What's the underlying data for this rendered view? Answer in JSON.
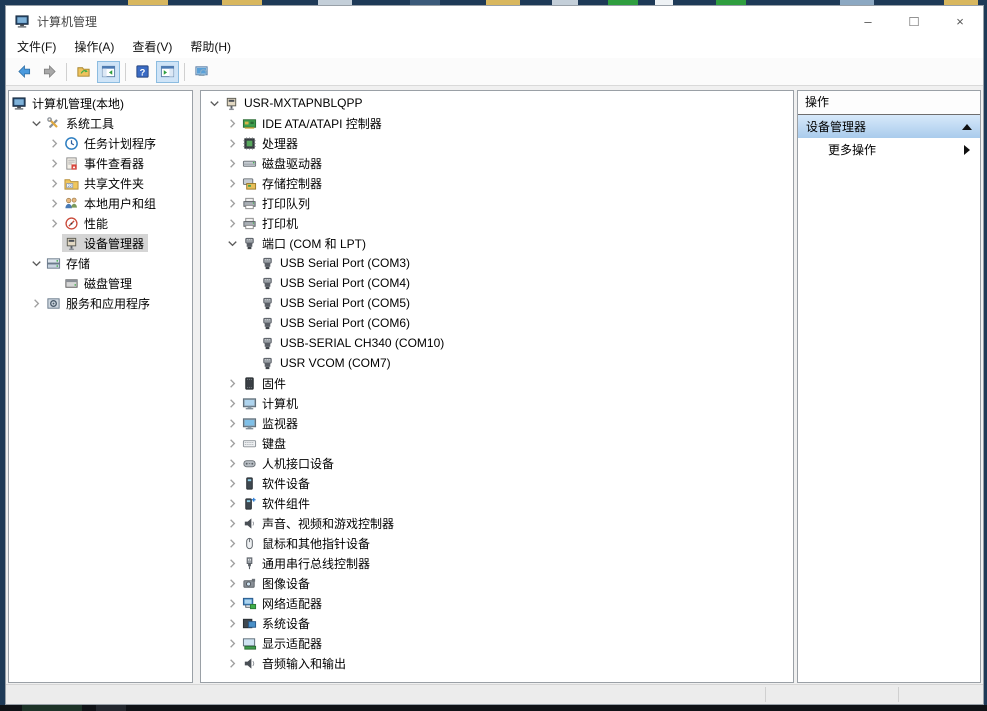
{
  "window": {
    "title": "计算机管理",
    "controls": [
      {
        "name": "minimize-button",
        "glyph": "–"
      },
      {
        "name": "maximize-button",
        "glyph": "□"
      },
      {
        "name": "close-button",
        "glyph": "×"
      }
    ]
  },
  "menu": {
    "items": [
      {
        "label": "文件(F)"
      },
      {
        "label": "操作(A)"
      },
      {
        "label": "查看(V)"
      },
      {
        "label": "帮助(H)"
      }
    ]
  },
  "toolbar": {
    "buttons": [
      {
        "name": "back-button",
        "icon": "back-arrow-icon",
        "active": false
      },
      {
        "name": "forward-button",
        "icon": "forward-arrow-icon",
        "active": false
      },
      {
        "name": "separator"
      },
      {
        "name": "export-list-button",
        "icon": "export-folder-icon",
        "active": false
      },
      {
        "name": "console-tree-toggle-button",
        "icon": "console-tree-icon",
        "active": true
      },
      {
        "name": "separator"
      },
      {
        "name": "help-button",
        "icon": "help-icon",
        "active": false
      },
      {
        "name": "action-pane-toggle-button",
        "icon": "action-pane-icon",
        "active": true
      },
      {
        "name": "separator"
      },
      {
        "name": "popup-window-button",
        "icon": "monitor-search-icon",
        "active": false
      }
    ]
  },
  "left_tree": {
    "items": [
      {
        "name": "sidebar-item-computer-management-local",
        "depth": 0,
        "chevron": "none",
        "icon": "computer-management-icon",
        "label": "计算机管理(本地)"
      },
      {
        "name": "sidebar-item-system-tools",
        "depth": 1,
        "chevron": "down",
        "icon": "system-tools-icon",
        "label": "系统工具"
      },
      {
        "name": "sidebar-item-task-scheduler",
        "depth": 2,
        "chevron": "right",
        "icon": "task-scheduler-icon",
        "label": "任务计划程序"
      },
      {
        "name": "sidebar-item-event-viewer",
        "depth": 2,
        "chevron": "right",
        "icon": "event-viewer-icon",
        "label": "事件查看器"
      },
      {
        "name": "sidebar-item-shared-folders",
        "depth": 2,
        "chevron": "right",
        "icon": "shared-folders-icon",
        "label": "共享文件夹"
      },
      {
        "name": "sidebar-item-local-users-groups",
        "depth": 2,
        "chevron": "right",
        "icon": "local-users-icon",
        "label": "本地用户和组"
      },
      {
        "name": "sidebar-item-performance",
        "depth": 2,
        "chevron": "right",
        "icon": "performance-icon",
        "label": "性能"
      },
      {
        "name": "sidebar-item-device-manager",
        "depth": 2,
        "chevron": "none",
        "icon": "device-manager-icon",
        "label": "设备管理器",
        "selected": true
      },
      {
        "name": "sidebar-item-storage",
        "depth": 1,
        "chevron": "down",
        "icon": "storage-icon",
        "label": "存储"
      },
      {
        "name": "sidebar-item-disk-management",
        "depth": 2,
        "chevron": "none",
        "icon": "disk-management-icon",
        "label": "磁盘管理"
      },
      {
        "name": "sidebar-item-services-applications",
        "depth": 1,
        "chevron": "right",
        "icon": "services-icon",
        "label": "服务和应用程序"
      }
    ]
  },
  "device_tree": {
    "items": [
      {
        "name": "device-node-root",
        "depth": 0,
        "chevron": "down",
        "icon": "device-manager-icon",
        "label": "USR-MXTAPNBLQPP"
      },
      {
        "name": "device-node-ide-controllers",
        "depth": 1,
        "chevron": "right",
        "icon": "ide-controller-icon",
        "label": "IDE ATA/ATAPI 控制器"
      },
      {
        "name": "device-node-processors",
        "depth": 1,
        "chevron": "right",
        "icon": "processor-icon",
        "label": "处理器"
      },
      {
        "name": "device-node-disk-drives",
        "depth": 1,
        "chevron": "right",
        "icon": "disk-drive-icon",
        "label": "磁盘驱动器"
      },
      {
        "name": "device-node-storage-controllers",
        "depth": 1,
        "chevron": "right",
        "icon": "storage-controller-icon",
        "label": "存储控制器"
      },
      {
        "name": "device-node-print-queues",
        "depth": 1,
        "chevron": "right",
        "icon": "print-queue-icon",
        "label": "打印队列"
      },
      {
        "name": "device-node-printers",
        "depth": 1,
        "chevron": "right",
        "icon": "printer-icon",
        "label": "打印机"
      },
      {
        "name": "device-node-ports-com-lpt",
        "depth": 1,
        "chevron": "down",
        "icon": "serial-port-icon",
        "label": "端口 (COM 和 LPT)"
      },
      {
        "name": "device-node-com3",
        "depth": 2,
        "chevron": "none",
        "icon": "serial-port-icon",
        "label": "USB Serial Port (COM3)"
      },
      {
        "name": "device-node-com4",
        "depth": 2,
        "chevron": "none",
        "icon": "serial-port-icon",
        "label": "USB Serial Port (COM4)"
      },
      {
        "name": "device-node-com5",
        "depth": 2,
        "chevron": "none",
        "icon": "serial-port-icon",
        "label": "USB Serial Port (COM5)"
      },
      {
        "name": "device-node-com6",
        "depth": 2,
        "chevron": "none",
        "icon": "serial-port-icon",
        "label": "USB Serial Port (COM6)"
      },
      {
        "name": "device-node-com10-ch340",
        "depth": 2,
        "chevron": "none",
        "icon": "serial-port-icon",
        "label": "USB-SERIAL CH340 (COM10)"
      },
      {
        "name": "device-node-com7-usr-vcom",
        "depth": 2,
        "chevron": "none",
        "icon": "serial-port-icon",
        "label": "USR VCOM (COM7)"
      },
      {
        "name": "device-node-firmware",
        "depth": 1,
        "chevron": "right",
        "icon": "firmware-icon",
        "label": "固件"
      },
      {
        "name": "device-node-computer",
        "depth": 1,
        "chevron": "right",
        "icon": "computer-icon",
        "label": "计算机"
      },
      {
        "name": "device-node-monitors",
        "depth": 1,
        "chevron": "right",
        "icon": "monitor-icon",
        "label": "监视器"
      },
      {
        "name": "device-node-keyboards",
        "depth": 1,
        "chevron": "right",
        "icon": "keyboard-icon",
        "label": "键盘"
      },
      {
        "name": "device-node-hid-devices",
        "depth": 1,
        "chevron": "right",
        "icon": "hid-icon",
        "label": "人机接口设备"
      },
      {
        "name": "device-node-software-devices",
        "depth": 1,
        "chevron": "right",
        "icon": "software-device-icon",
        "label": "软件设备"
      },
      {
        "name": "device-node-software-components",
        "depth": 1,
        "chevron": "right",
        "icon": "software-component-icon",
        "label": "软件组件"
      },
      {
        "name": "device-node-sound-video-game",
        "depth": 1,
        "chevron": "right",
        "icon": "sound-icon",
        "label": "声音、视频和游戏控制器"
      },
      {
        "name": "device-node-mice-pointing",
        "depth": 1,
        "chevron": "right",
        "icon": "mouse-icon",
        "label": "鼠标和其他指针设备"
      },
      {
        "name": "device-node-usb-controllers",
        "depth": 1,
        "chevron": "right",
        "icon": "usb-icon",
        "label": "通用串行总线控制器"
      },
      {
        "name": "device-node-imaging-devices",
        "depth": 1,
        "chevron": "right",
        "icon": "imaging-device-icon",
        "label": "图像设备"
      },
      {
        "name": "device-node-network-adapters",
        "depth": 1,
        "chevron": "right",
        "icon": "network-adapter-icon",
        "label": "网络适配器"
      },
      {
        "name": "device-node-system-devices",
        "depth": 1,
        "chevron": "right",
        "icon": "system-device-icon",
        "label": "系统设备"
      },
      {
        "name": "device-node-display-adapters",
        "depth": 1,
        "chevron": "right",
        "icon": "display-adapter-icon",
        "label": "显示适配器"
      },
      {
        "name": "device-node-audio-io",
        "depth": 1,
        "chevron": "right",
        "icon": "audio-icon",
        "label": "音频输入和输出"
      }
    ]
  },
  "action_pane": {
    "header": "操作",
    "group_title": "设备管理器",
    "more_actions_label": "更多操作"
  },
  "colors": {
    "desktop_bg": "#1e3a57",
    "tree_selection_bg": "#d5d5d5",
    "toolbar_active_bg": "#cfe4f7",
    "toolbar_active_border": "#8cbce0",
    "action_gradient_top": "#d7e9fa",
    "action_gradient_bottom": "#a9cbec"
  }
}
